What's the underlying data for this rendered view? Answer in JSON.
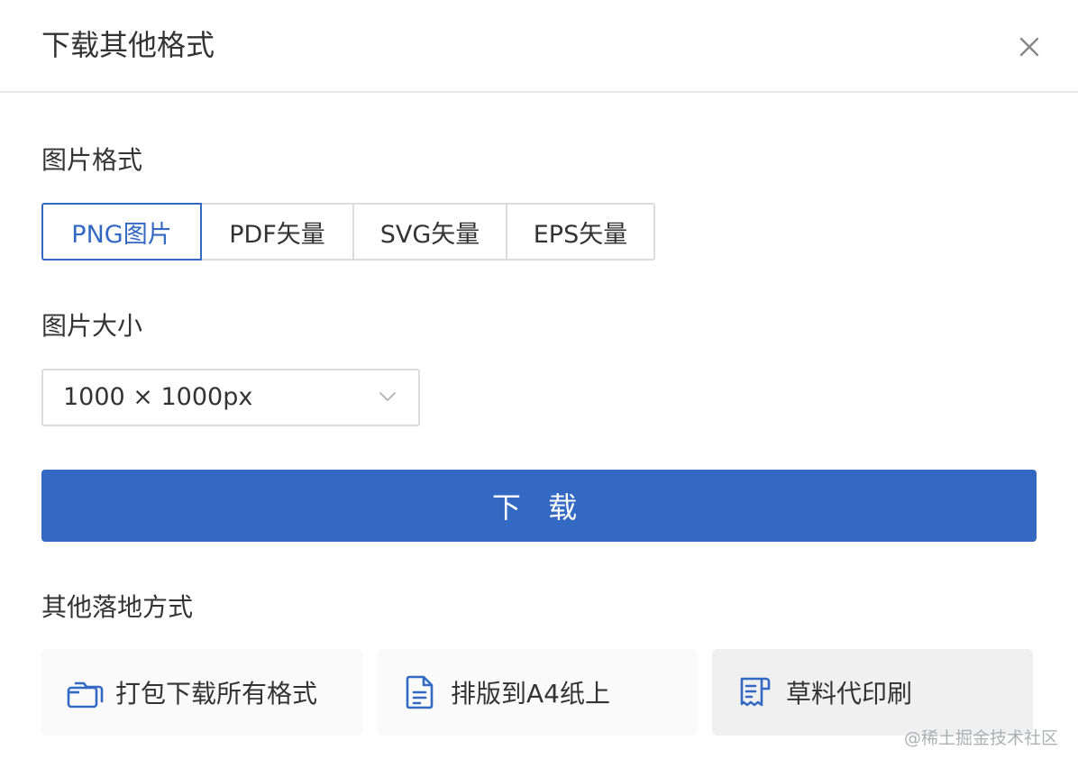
{
  "dialog": {
    "title": "下载其他格式",
    "close_icon": "close-icon"
  },
  "format_section": {
    "label": "图片格式",
    "options": [
      {
        "label": "PNG图片",
        "selected": true
      },
      {
        "label": "PDF矢量",
        "selected": false
      },
      {
        "label": "SVG矢量",
        "selected": false
      },
      {
        "label": "EPS矢量",
        "selected": false
      }
    ]
  },
  "size_section": {
    "label": "图片大小",
    "selected_value": "1000 × 1000px",
    "dropdown_icon": "chevron-down-icon"
  },
  "download_button": {
    "label": "下 载"
  },
  "other_section": {
    "label": "其他落地方式",
    "options": [
      {
        "label": "打包下载所有格式",
        "icon": "folders-icon"
      },
      {
        "label": "排版到A4纸上",
        "icon": "document-icon"
      },
      {
        "label": "草料代印刷",
        "icon": "print-receipt-icon"
      }
    ]
  },
  "watermark": "@稀土掘金技术社区",
  "colors": {
    "accent": "#3369c3",
    "border": "#dcdcdc",
    "card_bg": "#fafafa",
    "card_hover_bg": "#f0f0f0",
    "text": "#333333"
  }
}
